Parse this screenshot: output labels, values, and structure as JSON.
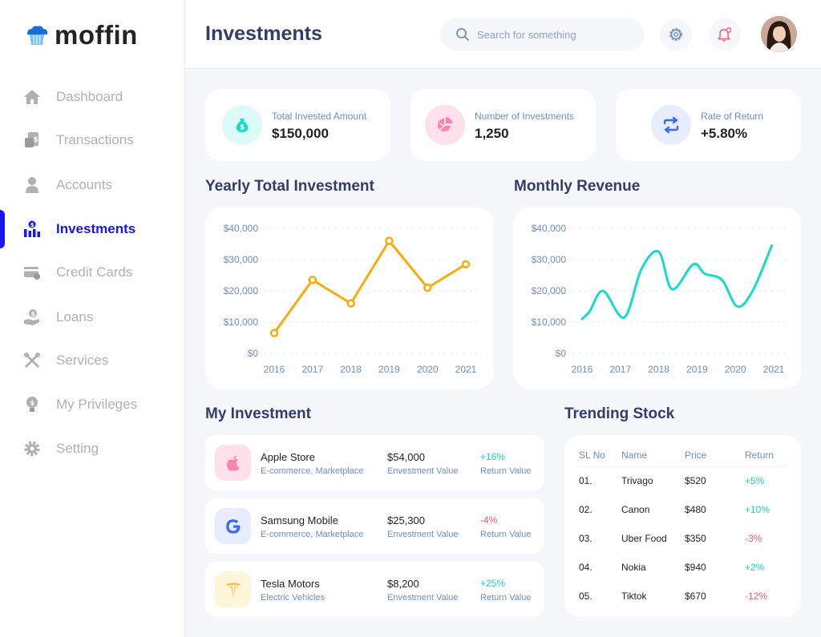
{
  "app": {
    "name": "moffin"
  },
  "sidebar": {
    "items": [
      {
        "label": "Dashboard",
        "icon": "home-icon"
      },
      {
        "label": "Transactions",
        "icon": "transfer-icon"
      },
      {
        "label": "Accounts",
        "icon": "user-icon"
      },
      {
        "label": "Investments",
        "icon": "investment-icon"
      },
      {
        "label": "Credit Cards",
        "icon": "credit-card-icon"
      },
      {
        "label": "Loans",
        "icon": "loan-icon"
      },
      {
        "label": "Services",
        "icon": "services-icon"
      },
      {
        "label": "My Privileges",
        "icon": "privileges-icon"
      },
      {
        "label": "Setting",
        "icon": "settings-icon"
      }
    ],
    "active": "Investments"
  },
  "header": {
    "title": "Investments",
    "search_placeholder": "Search for something"
  },
  "stats": [
    {
      "label": "Total Invested Amount",
      "value": "$150,000",
      "icon": "money-bag-icon",
      "color": "#16dbcc"
    },
    {
      "label": "Number of Investments",
      "value": "1,250",
      "icon": "pie-chart-icon",
      "color": "#ff82ac"
    },
    {
      "label": "Rate of Return",
      "value": "+5.80%",
      "icon": "repeat-icon",
      "color": "#396aff"
    }
  ],
  "sections": {
    "yearly": "Yearly Total Investment",
    "monthly": "Monthly Revenue",
    "my_investment": "My Investment",
    "trending": "Trending Stock"
  },
  "chart_data": [
    {
      "type": "line",
      "title": "Yearly Total Investment",
      "categories": [
        "2016",
        "2017",
        "2018",
        "2019",
        "2020",
        "2021"
      ],
      "values": [
        6500,
        23500,
        16000,
        36000,
        21000,
        28500
      ],
      "y_ticks": [
        "$0",
        "$10,000",
        "$20,000",
        "$30,000",
        "$40,000"
      ],
      "ylim": [
        0,
        40000
      ],
      "color": "#fcaa0b",
      "markers": true
    },
    {
      "type": "line",
      "title": "Monthly Revenue",
      "categories": [
        "2016",
        "2017",
        "2018",
        "2019",
        "2020",
        "2021"
      ],
      "x": [
        2016,
        2016.2,
        2016.55,
        2017.1,
        2017.55,
        2018,
        2018.35,
        2018.9,
        2019.2,
        2019.65,
        2020.05,
        2020.45,
        2020.95
      ],
      "values": [
        11000,
        13500,
        20000,
        11500,
        27000,
        32500,
        20500,
        28500,
        25500,
        23500,
        15000,
        20000,
        34500
      ],
      "y_ticks": [
        "$0",
        "$10,000",
        "$20,000",
        "$30,000",
        "$40,000"
      ],
      "ylim": [
        0,
        40000
      ],
      "color": "#16dbcc",
      "smooth": true
    }
  ],
  "investments": [
    {
      "name": "Apple Store",
      "category": "E-commerce, Marketplace",
      "value": "$54,000",
      "value_label": "Envestment Value",
      "return": "+16%",
      "return_label": "Return Value",
      "positive": true,
      "icon": "apple-icon",
      "bg": "#ffe0eb",
      "fg": "#ff82ac"
    },
    {
      "name": "Samsung Mobile",
      "category": "E-commerce, Marketplace",
      "value": "$25,300",
      "value_label": "Envestment Value",
      "return": "-4%",
      "return_label": "Return Value",
      "positive": false,
      "icon": "google-icon",
      "bg": "#e7edff",
      "fg": "#396aff"
    },
    {
      "name": "Tesla Motors",
      "category": "Electric Vehicles",
      "value": "$8,200",
      "value_label": "Envestment Value",
      "return": "+25%",
      "return_label": "Return Value",
      "positive": true,
      "icon": "tesla-icon",
      "bg": "#fff5d9",
      "fg": "#ffbb38"
    }
  ],
  "trending": {
    "headers": [
      "SL No",
      "Name",
      "Price",
      "Return"
    ],
    "rows": [
      {
        "sl": "01.",
        "name": "Trivago",
        "price": "$520",
        "return": "+5%",
        "positive": true
      },
      {
        "sl": "02.",
        "name": "Canon",
        "price": "$480",
        "return": "+10%",
        "positive": true
      },
      {
        "sl": "03.",
        "name": "Uber Food",
        "price": "$350",
        "return": "-3%",
        "positive": false
      },
      {
        "sl": "04.",
        "name": "Nokia",
        "price": "$940",
        "return": "+2%",
        "positive": true
      },
      {
        "sl": "05.",
        "name": "Tiktok",
        "price": "$670",
        "return": "-12%",
        "positive": false
      }
    ]
  }
}
